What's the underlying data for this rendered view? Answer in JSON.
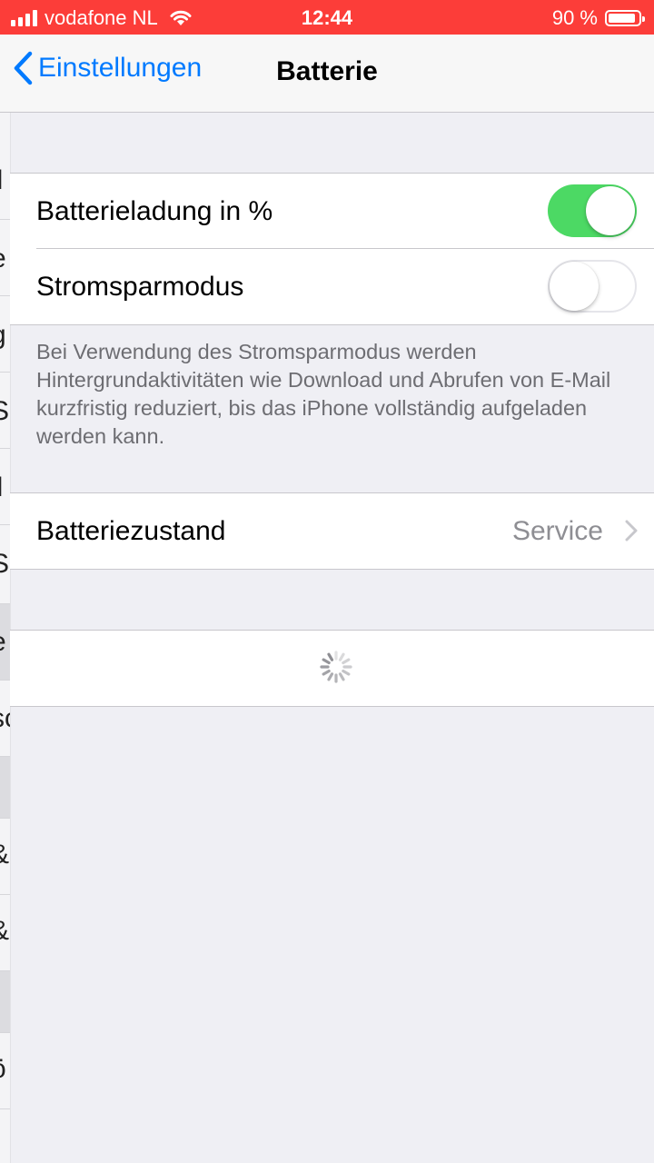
{
  "status_bar": {
    "carrier": "vodafone NL",
    "time": "12:44",
    "battery_percent_text": "90 %",
    "battery_level": 0.9,
    "signal_bars": 4
  },
  "nav": {
    "back_label": "Einstellungen",
    "title": "Batterie"
  },
  "settings": {
    "battery_percentage": {
      "label": "Batterieladung in %",
      "enabled": true
    },
    "low_power_mode": {
      "label": "Stromsparmodus",
      "enabled": false
    },
    "low_power_footer": "Bei Verwendung des Stromsparmodus werden Hintergrundaktivitäten wie Download und Abrufen von E-Mail kurzfristig reduziert, bis das iPhone vollständig aufgeladen werden kann.",
    "battery_health": {
      "label": "Batteriezustand",
      "detail": "Service"
    }
  },
  "previous_view_glyphs": [
    "ll",
    "e",
    "g",
    "Sı",
    "ll",
    "S",
    "e",
    "sc",
    "&",
    "&",
    "ö"
  ],
  "colors": {
    "status_bar": "#fc3d39",
    "tint": "#007aff",
    "toggle_on": "#4cd964",
    "background": "#efeff4"
  }
}
